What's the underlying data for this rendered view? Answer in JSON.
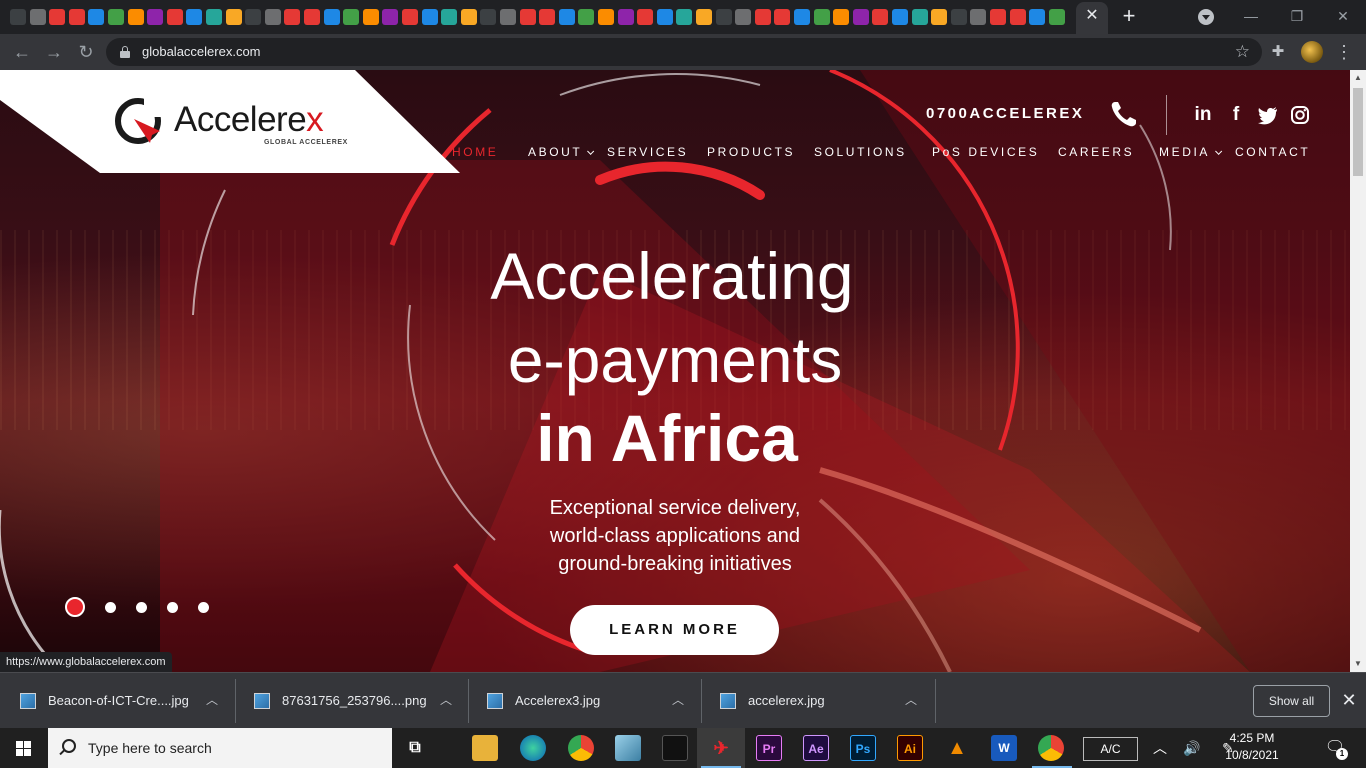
{
  "browser": {
    "url": "globalaccelerex.com",
    "status_url": "https://www.globalaccelerex.com",
    "tab_close": "✕",
    "new_tab": "+"
  },
  "site": {
    "logo_name_main": "Accelere",
    "logo_name_x": "x",
    "logo_sub": "GLOBAL ACCELEREX",
    "phone": "0700ACCELEREX",
    "social": [
      "in",
      "f",
      "t",
      "ig"
    ],
    "nav": [
      {
        "label": "HOME",
        "active": true
      },
      {
        "label": "ABOUT",
        "dropdown": true
      },
      {
        "label": "SERVICES"
      },
      {
        "label": "PRODUCTS"
      },
      {
        "label": "SOLUTIONS"
      },
      {
        "label": "PoS DEVICES"
      },
      {
        "label": "CAREERS"
      },
      {
        "label": "MEDIA",
        "dropdown": true
      },
      {
        "label": "CONTACT"
      }
    ],
    "hero": {
      "line1": "Accelerating",
      "line2": "e-payments",
      "line3": "in Africa",
      "sub1": "Exceptional service delivery,",
      "sub2": "world-class applications and",
      "sub3": "ground-breaking initiatives",
      "cta": "LEARN MORE"
    },
    "slider_dots": 5,
    "slider_active": 1
  },
  "downloads": {
    "items": [
      {
        "name": "Beacon-of-ICT-Cre....jpg"
      },
      {
        "name": "87631756_253796....png"
      },
      {
        "name": "Accelerex3.jpg"
      },
      {
        "name": "accelerex.jpg"
      }
    ],
    "show_all": "Show all"
  },
  "taskbar": {
    "search_placeholder": "Type here to search",
    "ac_label": "A/C",
    "time": "4:25 PM",
    "date": "10/8/2021",
    "notifications": "1"
  },
  "colors": {
    "brand_red": "#e8262d",
    "dark_red": "#5a1018"
  }
}
